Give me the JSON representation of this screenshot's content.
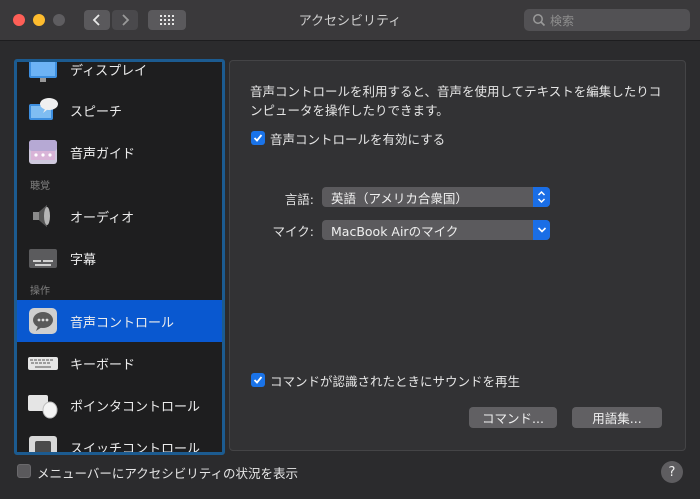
{
  "window": {
    "title": "アクセシビリティ"
  },
  "toolbar": {
    "search_placeholder": "検索",
    "back_icon": "chevron-left-icon",
    "forward_icon": "chevron-right-icon",
    "grid_icon": "grid-icon"
  },
  "sidebar": {
    "items": [
      {
        "label": "ディスプレイ",
        "icon": "display-icon"
      },
      {
        "label": "スピーチ",
        "icon": "speech-icon"
      },
      {
        "label": "音声ガイド",
        "icon": "voiceover-icon"
      },
      {
        "label": "オーディオ",
        "icon": "speaker-icon"
      },
      {
        "label": "字幕",
        "icon": "captions-icon"
      },
      {
        "label": "音声コントロール",
        "icon": "voice-control-icon",
        "selected": true
      },
      {
        "label": "キーボード",
        "icon": "keyboard-icon"
      },
      {
        "label": "ポインタコントロール",
        "icon": "pointer-control-icon"
      },
      {
        "label": "スイッチコントロール",
        "icon": "switch-control-icon"
      }
    ],
    "categories": {
      "hearing": "聴覚",
      "motor": "操作"
    }
  },
  "main": {
    "description": "音声コントロールを利用すると、音声を使用してテキストを編集したりコンピュータを操作したりできます。",
    "enable_checkbox": {
      "label": "音声コントロールを有効にする",
      "checked": true
    },
    "language": {
      "label": "言語:",
      "value": "英語（アメリカ合衆国）"
    },
    "mic": {
      "label": "マイク:",
      "value": "MacBook Airのマイク"
    },
    "sound_checkbox": {
      "label": "コマンドが認識されたときにサウンドを再生",
      "checked": true
    },
    "commands_button": "コマンド...",
    "vocabulary_button": "用語集..."
  },
  "footer": {
    "menubar_checkbox": {
      "label": "メニューバーにアクセシビリティの状況を表示",
      "checked": false
    },
    "help_button": "?"
  },
  "colors": {
    "accent": "#1a73e8",
    "selection": "#0958d0"
  }
}
